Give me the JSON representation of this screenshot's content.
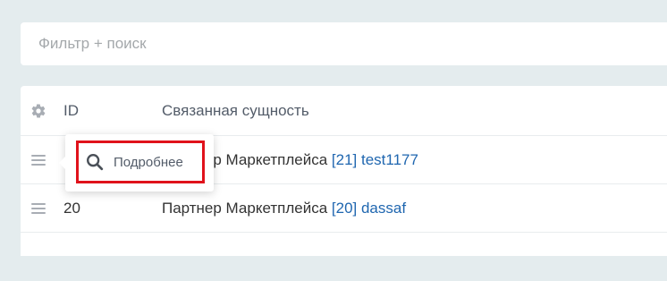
{
  "filter": {
    "placeholder": "Фильтр + поиск",
    "value": ""
  },
  "grid": {
    "columns": {
      "settings_icon": "gear-icon",
      "id": "ID",
      "entity": "Связанная сущность"
    },
    "rows": [
      {
        "id": "",
        "entity_prefix": "Партнер Маркетплейса ",
        "entity_link": "[21] test1177"
      },
      {
        "id": "20",
        "entity_prefix": "Партнер Маркетплейса ",
        "entity_link": "[20] dassaf"
      },
      {
        "id": "",
        "entity_prefix": "",
        "entity_link": ""
      }
    ]
  },
  "context_menu": {
    "item_icon": "search-icon",
    "item_label": "Подробнее",
    "highlight_color": "#e0121b"
  },
  "colors": {
    "background": "#e4ecee",
    "link": "#2067b0",
    "text": "#333333",
    "muted": "#535c69"
  }
}
